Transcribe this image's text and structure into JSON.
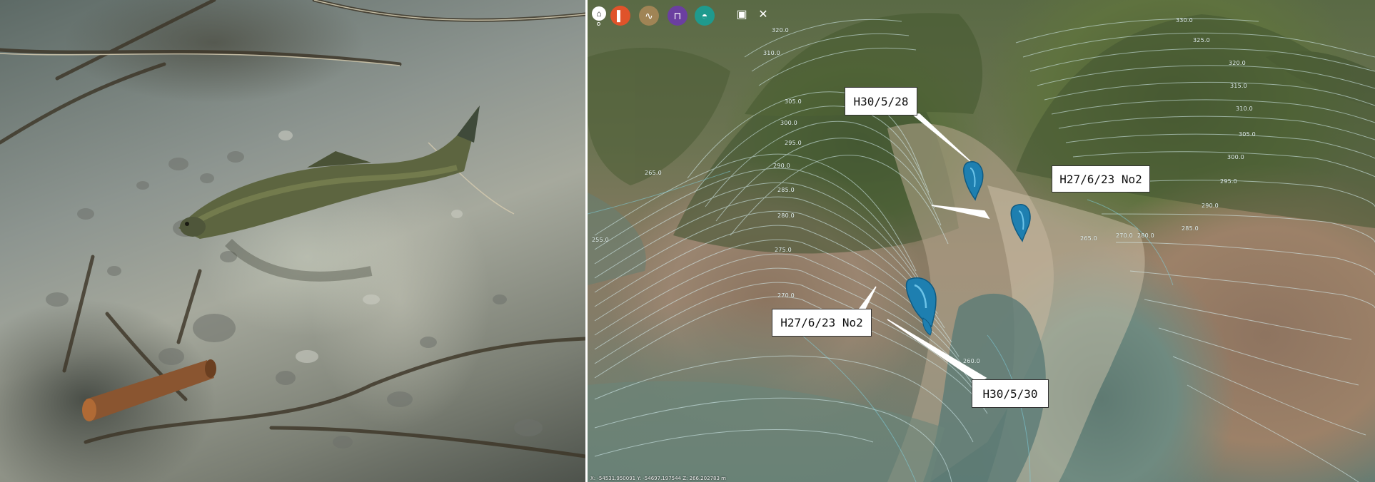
{
  "photo": {
    "subject": "fish-underwater"
  },
  "map": {
    "toolbar": {
      "icons": [
        {
          "name": "home-icon",
          "glyph": "⌂",
          "color": "#ffffff"
        },
        {
          "name": "layer-tool-icon",
          "glyph": "▌",
          "color": "#e0532a"
        },
        {
          "name": "terrain-tool-icon",
          "glyph": "∿",
          "color": "#a08455"
        },
        {
          "name": "bridge-tool-icon",
          "glyph": "⊓",
          "color": "#6b3fa0"
        },
        {
          "name": "water-tool-icon",
          "glyph": "◓",
          "color": "#1f9a8e"
        },
        {
          "name": "screen-icon",
          "glyph": "▣",
          "color": "#ffffff"
        },
        {
          "name": "tools-icon",
          "glyph": "✕",
          "color": "#ffffff"
        }
      ]
    },
    "contour_labels": [
      "330.0",
      "325.0",
      "320.0",
      "315.0",
      "310.0",
      "305.0",
      "300.0",
      "295.0",
      "290.0",
      "285.0",
      "320.0",
      "310.0",
      "305.0",
      "300.0",
      "295.0",
      "290.0",
      "285.0",
      "280.0",
      "275.0",
      "270.0",
      "265.0",
      "255.0",
      "265.0",
      "270.0",
      "280.0",
      "260.0"
    ],
    "callouts": [
      {
        "name": "callout-h30-5-28",
        "label": "H30/5/28"
      },
      {
        "name": "callout-h27-6-23-upper",
        "label": "H27/6/23 No2"
      },
      {
        "name": "callout-h27-6-23-lower",
        "label": "H27/6/23 No2"
      },
      {
        "name": "callout-h30-5-30",
        "label": "H30/5/30"
      }
    ],
    "marker_color": "#1e7fb0",
    "coordinates": "X: -54531.950091  Y: -54697.197544  Z: 266.202783 m"
  }
}
